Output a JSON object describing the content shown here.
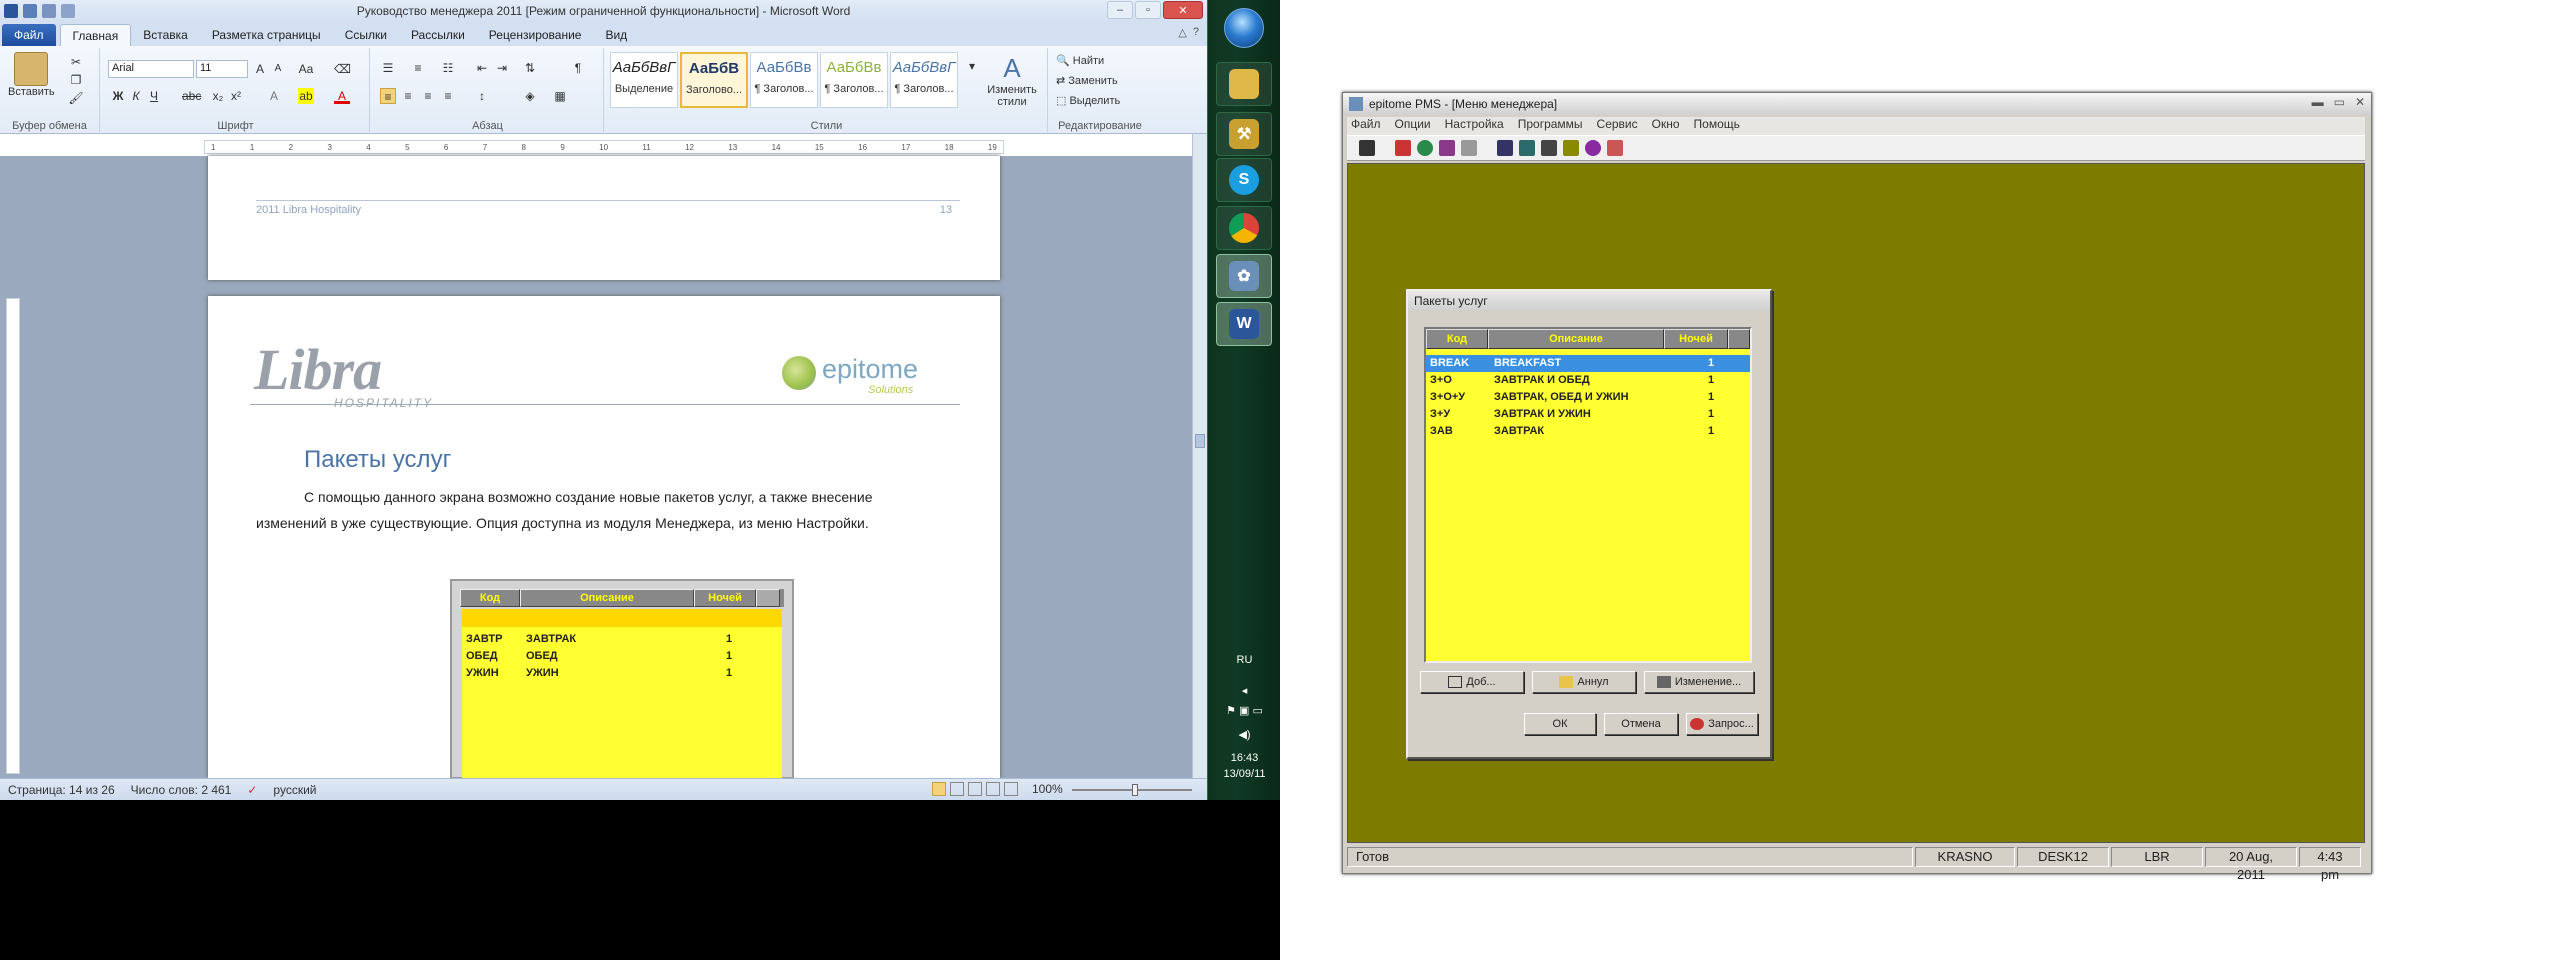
{
  "word": {
    "title": "Руководство менеджера 2011 [Режим ограниченной функциональности] - Microsoft Word",
    "tabs": [
      "Файл",
      "Главная",
      "Вставка",
      "Разметка страницы",
      "Ссылки",
      "Рассылки",
      "Рецензирование",
      "Вид"
    ],
    "clipboard": {
      "paste": "Вставить",
      "group": "Буфер обмена"
    },
    "font": {
      "name": "Arial",
      "size": "11",
      "group": "Шрифт"
    },
    "paragraph_group": "Абзац",
    "styles": {
      "items": [
        {
          "sample": "АаБбВвГ",
          "name": "Выделение"
        },
        {
          "sample": "АаБбВ",
          "name": "Заголово..."
        },
        {
          "sample": "АаБбВв",
          "name": "¶ Заголов..."
        },
        {
          "sample": "АаБбВв",
          "name": "¶ Заголов..."
        },
        {
          "sample": "АаБбВвГ",
          "name": "¶ Заголов..."
        }
      ],
      "change": "Изменить стили",
      "group": "Стили"
    },
    "editing": {
      "find": "Найти",
      "replace": "Заменить",
      "select": "Выделить",
      "group": "Редактирование"
    },
    "page_footer": {
      "text": "2011 Libra Hospitality",
      "num": "13"
    },
    "logo": {
      "libra": "Libra",
      "libra_sub": "HOSPITALITY",
      "epitome": "epitome",
      "solutions": "Solutions"
    },
    "heading": "Пакеты услуг",
    "paragraph": "С помощью данного экрана возможно создание новые пакетов услуг, а также внесение изменений в уже существующие. Опция доступна из модуля Менеджера, из меню Настройки.",
    "embedded_table": {
      "headers": [
        "Код",
        "Описание",
        "Ночей"
      ],
      "rows": [
        {
          "code": "ЗАВТР",
          "desc": "ЗАВТРАК",
          "nights": "1"
        },
        {
          "code": "ОБЕД",
          "desc": "ОБЕД",
          "nights": "1"
        },
        {
          "code": "УЖИН",
          "desc": "УЖИН",
          "nights": "1"
        }
      ]
    },
    "status": {
      "page": "Страница: 14 из 26",
      "words": "Число слов: 2 461",
      "lang": "русский",
      "zoom": "100%"
    }
  },
  "taskbar": {
    "lang": "RU",
    "time": "16:43",
    "date": "13/09/11"
  },
  "epitome": {
    "title": "epitome PMS - [Меню менеджера]",
    "menu": [
      "Файл",
      "Опции",
      "Настройка",
      "Программы",
      "Сервис",
      "Окно",
      "Помощь"
    ],
    "status": [
      "Готов",
      "KRASNO",
      "DESK12",
      "LBR",
      "20 Aug, 2011",
      "4:43 pm"
    ],
    "client_color": "#7e7c00"
  },
  "dialog": {
    "title": "Пакеты услуг",
    "headers": [
      "Код",
      "Описание",
      "Ночей"
    ],
    "rows": [
      {
        "code": "BREAK",
        "desc": "BREAKFAST",
        "nights": "1",
        "selected": true
      },
      {
        "code": "З+О",
        "desc": "ЗАВТРАК И ОБЕД",
        "nights": "1"
      },
      {
        "code": "З+О+У",
        "desc": "ЗАВТРАК, ОБЕД И УЖИН",
        "nights": "1"
      },
      {
        "code": "З+У",
        "desc": "ЗАВТРАК И УЖИН",
        "nights": "1"
      },
      {
        "code": "ЗАВ",
        "desc": "ЗАВТРАК",
        "nights": "1"
      }
    ],
    "buttons": {
      "add": "Доб...",
      "cancel": "Аннул",
      "change": "Изменение...",
      "ok": "ОК",
      "close": "Отмена",
      "query": "Запрос..."
    }
  }
}
